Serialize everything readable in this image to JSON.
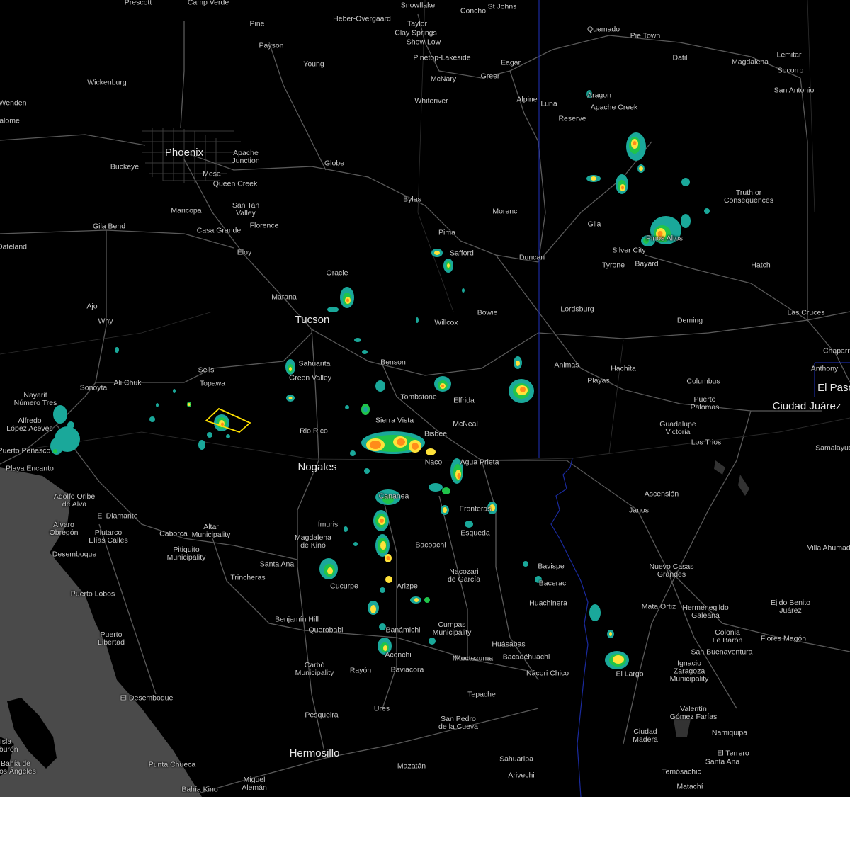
{
  "map": {
    "cities_major": [
      "Phoenix",
      "Tucson",
      "Nogales",
      "Ciudad Juárez",
      "Hermosillo",
      "El Paso"
    ],
    "places": [
      "Prescott",
      "Camp Verde",
      "Snowflake",
      "Concho",
      "St Johns",
      "Heber-Overgaard",
      "Taylor",
      "Clay Springs",
      "Show Low",
      "Pine",
      "Payson",
      "Young",
      "Pinetop-Lakeside",
      "McNary",
      "Eagar",
      "Greer",
      "Quemado",
      "Pie Town",
      "Datil",
      "Magdalena",
      "Lemitar",
      "Socorro",
      "San Antonio",
      "Wickenburg",
      "Wenden",
      "Salome",
      "Aragon",
      "Apache Creek",
      "Whiteriver",
      "Alpine",
      "Luna",
      "Reserve",
      "Buckeye",
      "Mesa",
      "Apache\nJunction",
      "Globe",
      "Queen Creek",
      "San Tan\nValley",
      "Maricopa",
      "Florence",
      "Casa Grande",
      "Gila Bend",
      "Eloy",
      "Bylas",
      "Truth or\nConsequences",
      "Morenci",
      "Gila",
      "Pima",
      "Safford",
      "Duncan",
      "Silver City",
      "Pinos Altos",
      "Tyrone",
      "Bayard",
      "Hatch",
      "Dateland",
      "Oracle",
      "Marana",
      "Ajo",
      "Why",
      "Bowie",
      "Lordsburg",
      "Deming",
      "Las Cruces",
      "Willcox",
      "Sells",
      "Sahuarita",
      "Green Valley",
      "Benson",
      "Animas",
      "Hachita",
      "Playas",
      "Columbus",
      "Anthony",
      "Chaparral",
      "Topawa",
      "Ali Chuk",
      "Sonoyta",
      "Tombstone",
      "Elfrida",
      "Nayarit\nNúmero Tres",
      "Alfredo\nLópez Aceves",
      "Puerto\nPalomas",
      "Sierra Vista",
      "McNeal",
      "Guadalupe\nVictoria",
      "Los Trios",
      "Rio Rico",
      "Bisbee",
      "Naco",
      "Agua Prieta",
      "Puerto Peñasco",
      "Playa Encanto",
      "Samalayuca",
      "Cananea",
      "Ascensión",
      "Adolfo Oribe\nde Alva",
      "Janos",
      "Fronteras",
      "El Diamante",
      "Álvaro\nObregón",
      "Plutarco\nElías Calles",
      "Caborca",
      "Altar\nMunicipality",
      "Ímuris",
      "Esqueda",
      "Villa Ahumada",
      "Pitiquito\nMunicipality",
      "Magdalena\nde Kinó",
      "Bacoachi",
      "Desemboque",
      "Santa Ana",
      "Bavispe",
      "Nuevo Casas\nGrandes",
      "Nacozari\nde García",
      "Trincheras",
      "Bacerac",
      "Puerto Lobos",
      "Cucurpe",
      "Arizpe",
      "Huachinera",
      "Mata Ortiz",
      "Hermenegildo\nGaleana",
      "Ejido Benito\nJuárez",
      "Moctezuma",
      "Benjamín Hill",
      "Querobabi",
      "Colonia\nLe Barón",
      "Puerto\nLibertad",
      "Banámichi",
      "Cumpas\nMunicipality",
      "Flores Magón",
      "Huásabas",
      "Aconchi",
      "Bacadéhuachi",
      "San Buenaventura",
      "Moctezuma",
      "El Largo",
      "Carbó\nMunicipality",
      "Rayón",
      "Baviácora",
      "Nácori Chico",
      "Ignacio\nZaragoza\nMunicipality",
      "El Desemboque",
      "Tepache",
      "Pesqueira",
      "Ures",
      "Valentín\nGómez Farías",
      "San Pedro\nde la Cueva",
      "Ciudad\nMadera",
      "Namiquipa",
      "El Terrero",
      "Santa Ana",
      "Sahuaripa",
      "Punta Chueca",
      "Mazatán",
      "Temósachic",
      "Arivechi",
      "Miguel\nAlemán",
      "Bahía Kino",
      "Matachí",
      "Bahía de\nLos Ángeles",
      "Isla\nTiburón"
    ],
    "colors": {
      "background": "#000000",
      "water": "#4a4a4a",
      "roads": "#5a5a5a",
      "border": "#1a2a9e",
      "warning_polygon": "#ffe000",
      "radar_light": "#1aa89a",
      "radar_mid": "#20c44a",
      "radar_yellow": "#ffe23a",
      "radar_orange": "#ff8c1a",
      "radar_red": "#e8281e"
    }
  }
}
